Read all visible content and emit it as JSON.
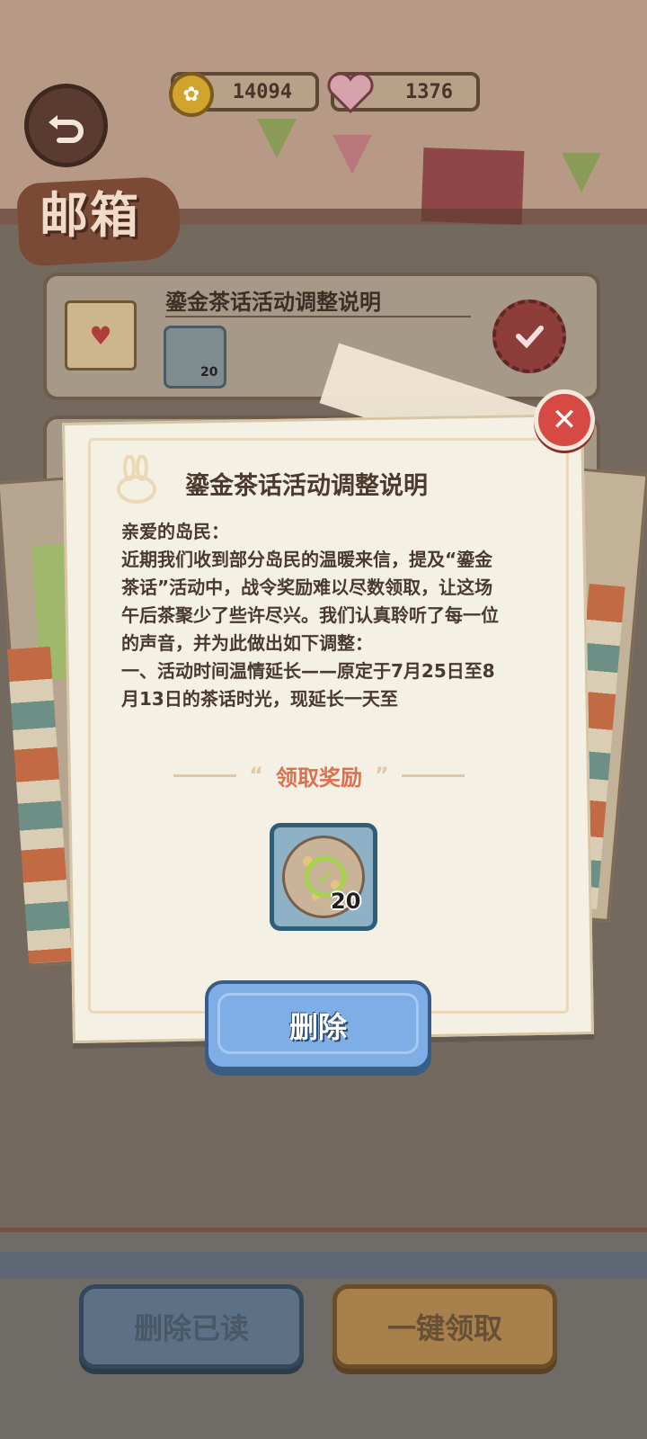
{
  "hud": {
    "coins": "14094",
    "hearts": "1376"
  },
  "page_title": "邮箱",
  "mail_list": {
    "items": [
      {
        "title": "鎏金茶话活动调整说明",
        "reward_count": "20"
      }
    ]
  },
  "modal": {
    "title": "鎏金茶话活动调整说明",
    "body": "亲爱的岛民：\n近期我们收到部分岛民的温暖来信，提及“鎏金茶话”活动中，战令奖励难以尽数领取，让这场午后茶聚少了些许尽兴。我们认真聆听了每一位的声音，并为此做出如下调整：\n一、活动时间温情延长——原定于7月25日至8月13日的茶话时光，现延长一天至",
    "reward_section_label": "领取奖励",
    "reward_item": {
      "count": "20"
    },
    "delete_button": "删除"
  },
  "bottom_bar": {
    "delete_read": "删除已读",
    "claim_all": "一键领取"
  },
  "colors": {
    "accent_red": "#d64a43",
    "reward_label": "#de7050",
    "delete_blue": "#7eaee5"
  },
  "icons": [
    "back-arrow-icon",
    "coin-icon",
    "heart-icon",
    "envelope-icon",
    "seal-check-icon",
    "bunny-icon",
    "close-icon",
    "check-icon"
  ]
}
